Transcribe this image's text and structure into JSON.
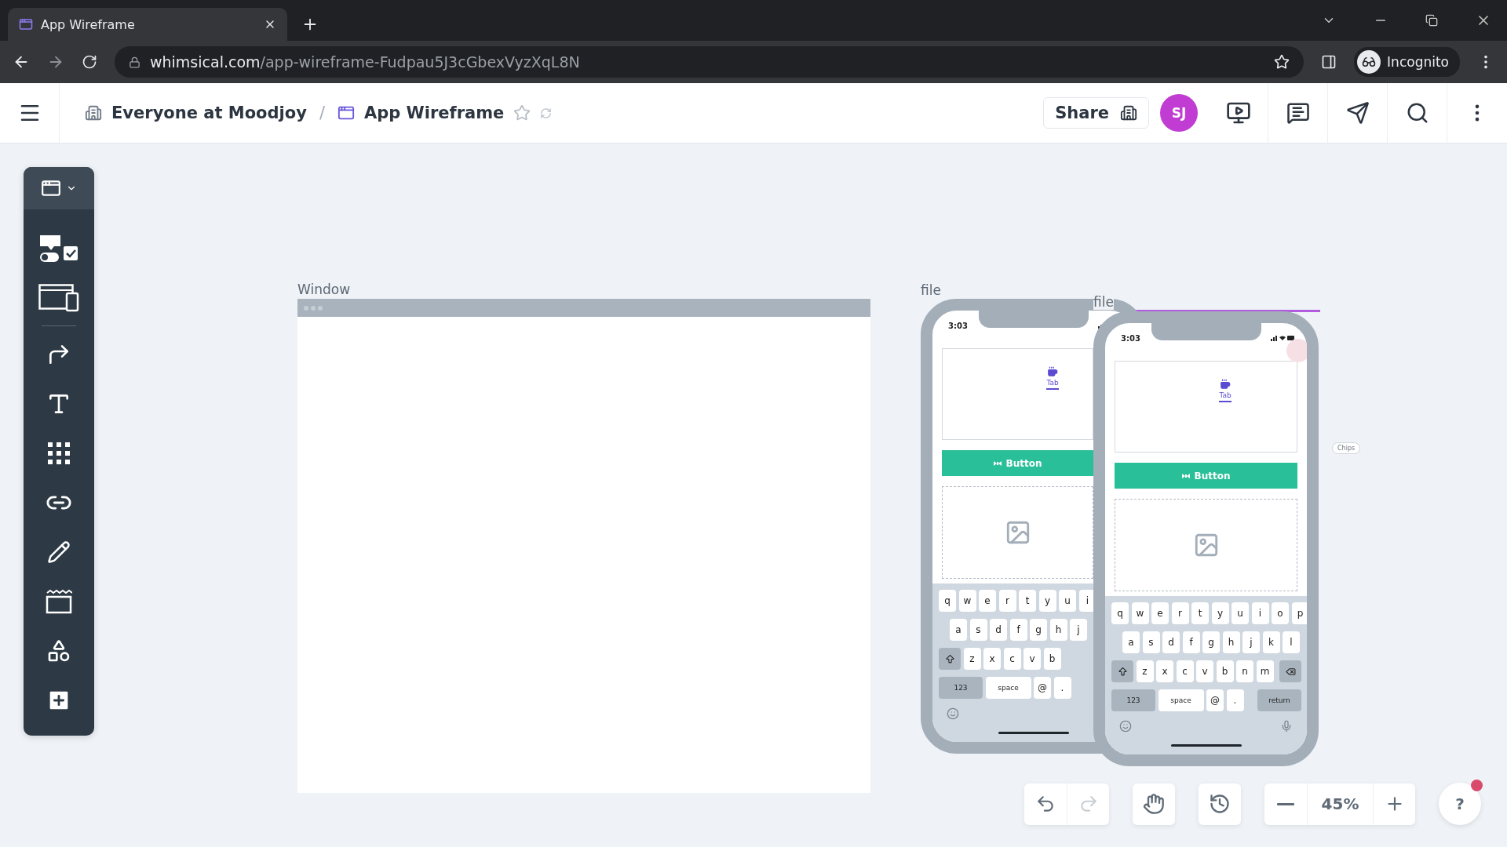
{
  "browser": {
    "tab_title": "App Wireframe",
    "url_host": "whimsical.com",
    "url_path": "/app-wireframe-Fudpau5J3cGbexVyzXqL8N",
    "profile": "Incognito"
  },
  "header": {
    "breadcrumb": [
      {
        "label": "Everyone at Moodjoy",
        "kind": "team"
      },
      {
        "label": "App Wireframe",
        "kind": "board"
      }
    ],
    "separator": "/",
    "starred": false,
    "share": "Share",
    "avatar": "SJ"
  },
  "canvas": {
    "window": {
      "label": "Window"
    },
    "phones": [
      {
        "label": "file",
        "selected": false,
        "time": "3:03",
        "tab": "Tab",
        "button": "Button",
        "keys": [
          [
            {
              "kind": "letter",
              "label": "q"
            },
            {
              "kind": "letter",
              "label": "w"
            },
            {
              "kind": "letter",
              "label": "e"
            },
            {
              "kind": "letter",
              "label": "r"
            },
            {
              "kind": "letter",
              "label": "t"
            },
            {
              "kind": "letter",
              "label": "y"
            },
            {
              "kind": "letter",
              "label": "u"
            },
            {
              "kind": "letter",
              "label": "i"
            }
          ],
          [
            {
              "kind": "letter",
              "label": "a"
            },
            {
              "kind": "letter",
              "label": "s"
            },
            {
              "kind": "letter",
              "label": "d"
            },
            {
              "kind": "letter",
              "label": "f"
            },
            {
              "kind": "letter",
              "label": "g"
            },
            {
              "kind": "letter",
              "label": "h"
            },
            {
              "kind": "letter",
              "label": "j"
            }
          ],
          [
            {
              "kind": "shift"
            },
            {
              "kind": "letter",
              "label": "z"
            },
            {
              "kind": "letter",
              "label": "x"
            },
            {
              "kind": "letter",
              "label": "c"
            },
            {
              "kind": "letter",
              "label": "v"
            },
            {
              "kind": "letter",
              "label": "b"
            }
          ],
          [
            {
              "kind": "mode",
              "label": "123"
            },
            {
              "kind": "space",
              "label": "space"
            },
            {
              "kind": "letter",
              "label": "@"
            },
            {
              "kind": "letter",
              "label": "."
            }
          ]
        ]
      },
      {
        "label": "file",
        "selected": true,
        "time": "3:03",
        "tab": "Tab",
        "button": "Button",
        "keys": [
          [
            {
              "kind": "letter",
              "label": "q"
            },
            {
              "kind": "letter",
              "label": "w"
            },
            {
              "kind": "letter",
              "label": "e"
            },
            {
              "kind": "letter",
              "label": "r"
            },
            {
              "kind": "letter",
              "label": "t"
            },
            {
              "kind": "letter",
              "label": "y"
            },
            {
              "kind": "letter",
              "label": "u"
            },
            {
              "kind": "letter",
              "label": "i"
            },
            {
              "kind": "letter",
              "label": "o"
            },
            {
              "kind": "letter",
              "label": "p"
            }
          ],
          [
            {
              "kind": "letter",
              "label": "a"
            },
            {
              "kind": "letter",
              "label": "s"
            },
            {
              "kind": "letter",
              "label": "d"
            },
            {
              "kind": "letter",
              "label": "f"
            },
            {
              "kind": "letter",
              "label": "g"
            },
            {
              "kind": "letter",
              "label": "h"
            },
            {
              "kind": "letter",
              "label": "j"
            },
            {
              "kind": "letter",
              "label": "k"
            },
            {
              "kind": "letter",
              "label": "l"
            }
          ],
          [
            {
              "kind": "shift"
            },
            {
              "kind": "letter",
              "label": "z"
            },
            {
              "kind": "letter",
              "label": "x"
            },
            {
              "kind": "letter",
              "label": "c"
            },
            {
              "kind": "letter",
              "label": "v"
            },
            {
              "kind": "letter",
              "label": "b"
            },
            {
              "kind": "letter",
              "label": "n"
            },
            {
              "kind": "letter",
              "label": "m"
            },
            {
              "kind": "backspace"
            }
          ],
          [
            {
              "kind": "mode",
              "label": "123"
            },
            {
              "kind": "space",
              "label": "space"
            },
            {
              "kind": "letter",
              "label": "@"
            },
            {
              "kind": "letter",
              "label": "."
            },
            {
              "kind": "return",
              "label": "return"
            }
          ]
        ]
      }
    ],
    "chip": "Chips"
  },
  "zoom": {
    "value": "45%"
  },
  "help": {
    "label": "?",
    "notification": true
  }
}
